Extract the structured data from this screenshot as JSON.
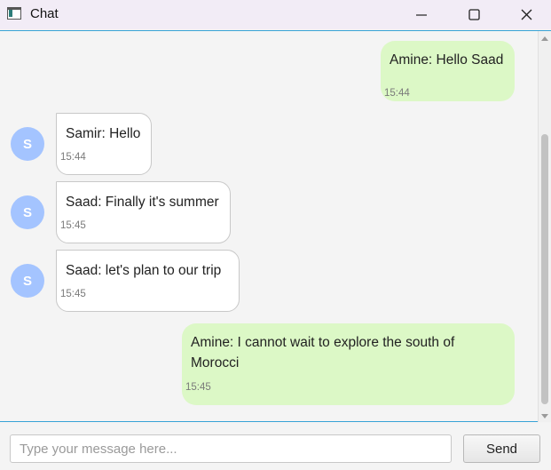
{
  "window": {
    "title": "Chat",
    "controls": {
      "minimize": "—",
      "maximize": "□",
      "close": "✕"
    }
  },
  "messages": [
    {
      "direction": "outgoing",
      "text": "Amine: Hello Saad",
      "time": "15:44"
    },
    {
      "direction": "incoming",
      "avatar": "S",
      "text": "Samir: Hello",
      "time": "15:44"
    },
    {
      "direction": "incoming",
      "avatar": "S",
      "text": "Saad: Finally it's summer",
      "time": "15:45"
    },
    {
      "direction": "incoming",
      "avatar": "S",
      "text": "Saad: let's plan to our trip",
      "time": "15:45"
    },
    {
      "direction": "outgoing",
      "text": "Amine: I cannot wait to explore the south of Morocci",
      "time": "15:45"
    }
  ],
  "composer": {
    "value": "",
    "placeholder": "Type your message here...",
    "send_label": "Send"
  },
  "colors": {
    "outgoing_bubble": "#dcf8c6",
    "incoming_bubble": "#ffffff",
    "avatar": "#a4c4ff",
    "accent_border": "#38a3d6"
  }
}
